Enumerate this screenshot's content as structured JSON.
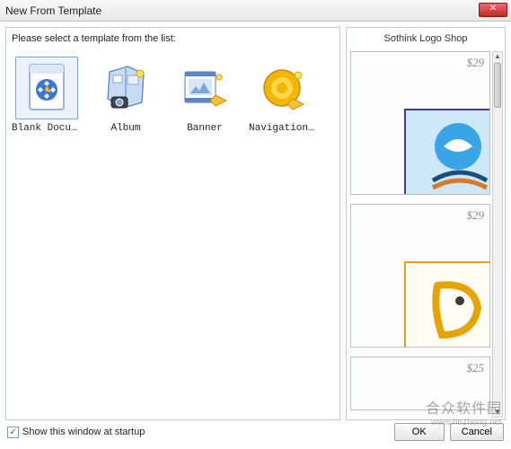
{
  "window": {
    "title": "New From Template"
  },
  "left": {
    "instruction": "Please select a template from the list:",
    "templates": [
      {
        "label": "Blank Document",
        "icon": "blank-doc-icon",
        "selected": true
      },
      {
        "label": "Album",
        "icon": "album-icon",
        "selected": false
      },
      {
        "label": "Banner",
        "icon": "banner-icon",
        "selected": false
      },
      {
        "label": "Navigation Bu..",
        "icon": "nav-button-icon",
        "selected": false
      }
    ]
  },
  "right": {
    "header": "Sothink Logo Shop",
    "items": [
      {
        "price": "$29"
      },
      {
        "price": "$29"
      },
      {
        "price": "$25"
      }
    ]
  },
  "footer": {
    "show_checked": true,
    "show_label": "Show this window at startup",
    "ok_label": "OK",
    "cancel_label": "Cancel"
  },
  "watermark": {
    "main": "合众软件园",
    "sub": "www.hezhong.net"
  }
}
